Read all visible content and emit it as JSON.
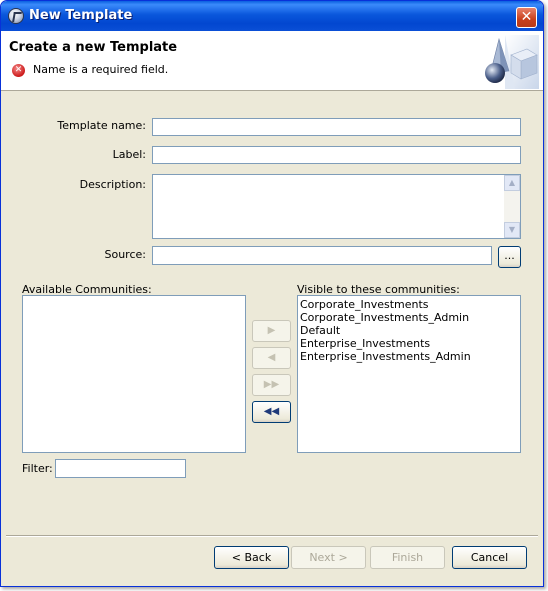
{
  "window": {
    "title": "New Template",
    "close_glyph": "✕"
  },
  "banner": {
    "title": "Create a new Template",
    "error_message": "Name is a required field.",
    "error_icon": "error-icon"
  },
  "form": {
    "template_name_label": "Template name:",
    "template_name_value": "",
    "label_label": "Label:",
    "label_value": "",
    "description_label": "Description:",
    "description_value": "",
    "source_label": "Source:",
    "source_value": "",
    "browse_label": "..."
  },
  "communities": {
    "available_label": "Available Communities:",
    "available_items": [],
    "visible_label": "Visible to these communities:",
    "visible_items": [
      "Corporate_Investments",
      "Corporate_Investments_Admin",
      "Default",
      "Enterprise_Investments",
      "Enterprise_Investments_Admin"
    ],
    "filter_label": "Filter:",
    "filter_value": "",
    "move_buttons": {
      "add_glyph": "▶",
      "remove_glyph": "◀",
      "add_all_glyph": "▶▶",
      "remove_all_glyph": "◀◀"
    }
  },
  "footer": {
    "back_label": "< Back",
    "next_label": "Next >",
    "finish_label": "Finish",
    "cancel_label": "Cancel"
  },
  "colors": {
    "titlebar": "#0a57dc",
    "accent_border": "#7f9db9",
    "error": "#cc1a1a"
  }
}
